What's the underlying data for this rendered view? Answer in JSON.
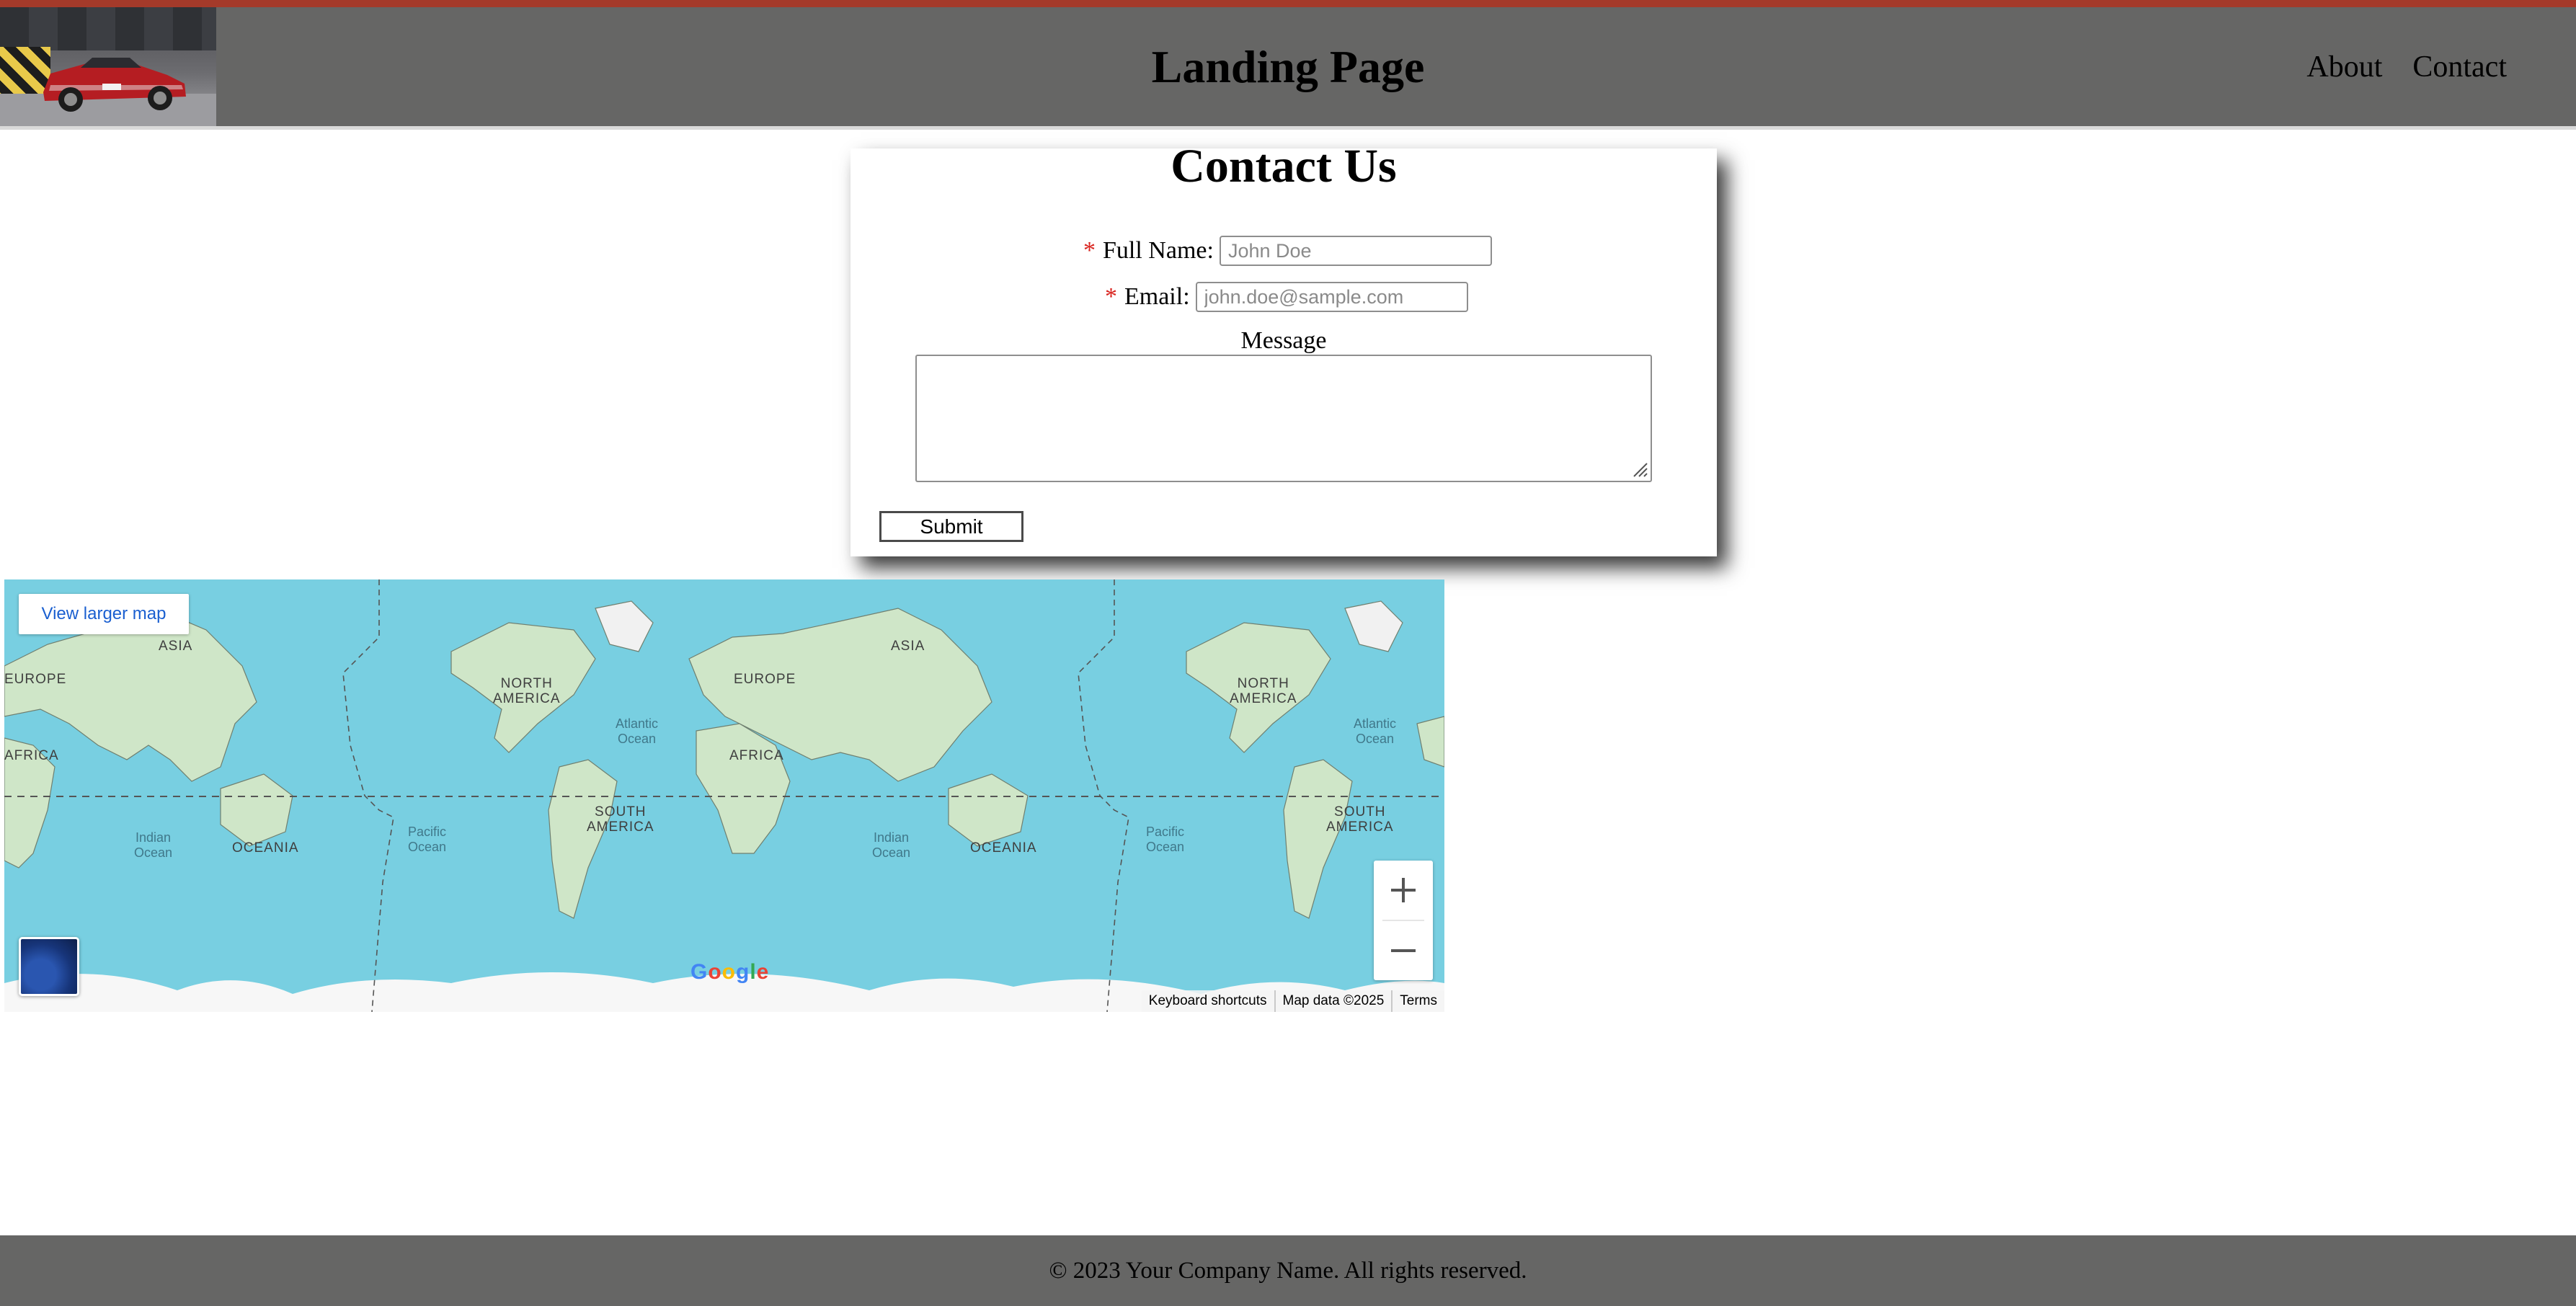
{
  "header": {
    "title": "Landing Page",
    "nav": [
      "About",
      "Contact"
    ],
    "logo_alt": "car-logo-image"
  },
  "contact": {
    "heading": "Contact Us",
    "required_marker": "*",
    "full_name_label": "Full Name:",
    "full_name_placeholder": "John Doe",
    "email_label": "Email:",
    "email_placeholder": "john.doe@sample.com",
    "message_label": "Message",
    "message_value": "",
    "submit_label": "Submit"
  },
  "map": {
    "view_larger": "View larger map",
    "labels": {
      "asia": "ASIA",
      "europe": "EUROPE",
      "africa": "AFRICA",
      "north_america": "NORTH\nAMERICA",
      "south_america": "SOUTH\nAMERICA",
      "oceania": "OCEANIA",
      "atlantic": "Atlantic\nOcean",
      "pacific": "Pacific\nOcean",
      "indian": "Indian\nOcean"
    },
    "zoom_in": "+",
    "zoom_out": "−",
    "google": "Google",
    "attribution": [
      "Keyboard shortcuts",
      "Map data ©2025",
      "Terms"
    ]
  },
  "footer": {
    "text": "© 2023 Your Company Name. All rights reserved."
  },
  "colors": {
    "header_bg": "#666665",
    "accent_line": "#a43a2a",
    "required": "#d9241f",
    "map_water": "#78cfe1",
    "map_land": "#cfe6c8",
    "link": "#1a5fd0"
  }
}
